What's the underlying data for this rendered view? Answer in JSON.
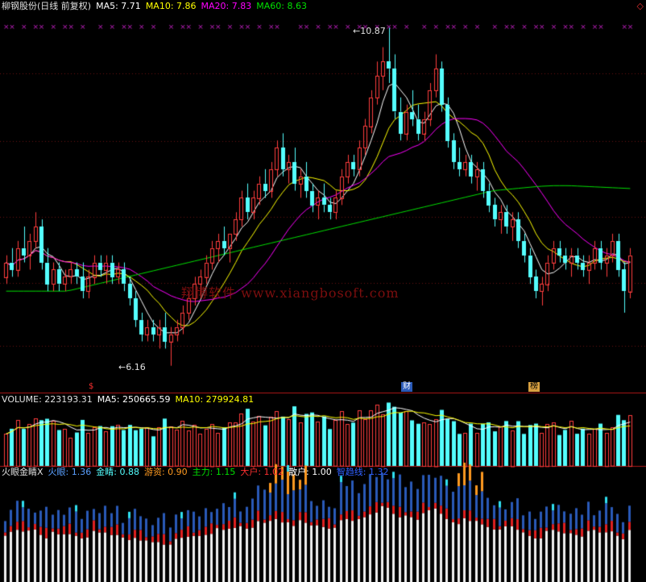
{
  "header_price": {
    "name": "柳钢股份(日线 前复权)",
    "ma5": "MA5: 7.71",
    "ma10": "MA10: 7.86",
    "ma20": "MA20: 7.83",
    "ma60": "MA60: 8.63"
  },
  "header_volume": {
    "volume": "VOLUME: 223193.31",
    "ma5": "MA5: 250665.59",
    "ma10": "MA10: 279924.81"
  },
  "header_indicator": {
    "name": "火眼金睛X",
    "huoyan": "火眼: 1.36",
    "jinjing": "金睛: 0.88",
    "youzi": "游资: 0.90",
    "zhuli": "主力: 1.15",
    "dahu": "大户: 1.02",
    "sanhu": "散户: 1.00",
    "zhiduxian": "智趋线: 1.32"
  },
  "watermark": "翔博软件 www.xiangbosoft.com",
  "markers": {
    "s": "$",
    "cai": "财",
    "bang": "榜"
  },
  "annotations": {
    "high": "10.87",
    "low": "6.16"
  },
  "colors": {
    "up": "#ff3c3c",
    "down": "#54ffff",
    "ma5": "#ffffff",
    "ma10": "#ffff00",
    "ma20": "#ff00ff",
    "ma60": "#00e000",
    "white_bar": "#f0f0f0",
    "blue_bar": "#2a5ab8",
    "red_bar": "#e02020",
    "orange_bar": "#ff9a20",
    "cyan_bar": "#30e0f0"
  },
  "chart_data": {
    "type": "candlestick",
    "price_range": [
      6.0,
      11.1
    ],
    "candles_ohlc": [
      [
        7.4,
        7.7,
        7.3,
        7.6
      ],
      [
        7.6,
        7.8,
        7.4,
        7.5
      ],
      [
        7.5,
        7.9,
        7.4,
        7.8
      ],
      [
        7.8,
        8.1,
        7.6,
        7.7
      ],
      [
        7.7,
        8.0,
        7.5,
        7.9
      ],
      [
        7.9,
        8.3,
        7.8,
        8.1
      ],
      [
        8.1,
        8.2,
        7.5,
        7.6
      ],
      [
        7.6,
        7.8,
        7.2,
        7.3
      ],
      [
        7.3,
        7.6,
        7.2,
        7.5
      ],
      [
        7.5,
        7.6,
        7.2,
        7.3
      ],
      [
        7.3,
        7.5,
        7.2,
        7.4
      ],
      [
        7.4,
        7.6,
        7.3,
        7.5
      ],
      [
        7.5,
        7.6,
        7.3,
        7.4
      ],
      [
        7.4,
        7.6,
        7.1,
        7.2
      ],
      [
        7.2,
        7.5,
        7.1,
        7.4
      ],
      [
        7.4,
        7.7,
        7.3,
        7.6
      ],
      [
        7.6,
        7.7,
        7.4,
        7.5
      ],
      [
        7.5,
        7.7,
        7.3,
        7.6
      ],
      [
        7.6,
        7.7,
        7.3,
        7.4
      ],
      [
        7.4,
        7.6,
        7.3,
        7.5
      ],
      [
        7.5,
        7.6,
        7.2,
        7.3
      ],
      [
        7.3,
        7.4,
        7.0,
        7.1
      ],
      [
        7.1,
        7.2,
        6.7,
        6.8
      ],
      [
        6.8,
        6.9,
        6.5,
        6.6
      ],
      [
        6.6,
        6.8,
        6.5,
        6.7
      ],
      [
        6.7,
        6.8,
        6.5,
        6.6
      ],
      [
        6.6,
        6.8,
        6.4,
        6.7
      ],
      [
        6.7,
        6.9,
        6.4,
        6.5
      ],
      [
        6.5,
        6.7,
        6.16,
        6.6
      ],
      [
        6.6,
        6.8,
        6.5,
        6.7
      ],
      [
        6.7,
        7.0,
        6.6,
        6.9
      ],
      [
        6.9,
        7.2,
        6.8,
        7.1
      ],
      [
        7.1,
        7.4,
        7.0,
        7.3
      ],
      [
        7.3,
        7.5,
        7.1,
        7.4
      ],
      [
        7.4,
        7.7,
        7.3,
        7.6
      ],
      [
        7.6,
        7.9,
        7.5,
        7.8
      ],
      [
        7.8,
        8.0,
        7.6,
        7.9
      ],
      [
        7.9,
        8.1,
        7.7,
        7.8
      ],
      [
        7.8,
        8.0,
        7.6,
        8.0
      ],
      [
        8.0,
        8.3,
        7.9,
        8.2
      ],
      [
        8.2,
        8.6,
        8.1,
        8.5
      ],
      [
        8.5,
        8.7,
        8.2,
        8.3
      ],
      [
        8.3,
        8.6,
        8.2,
        8.5
      ],
      [
        8.5,
        8.8,
        8.4,
        8.7
      ],
      [
        8.7,
        8.9,
        8.5,
        8.6
      ],
      [
        8.6,
        9.0,
        8.5,
        8.9
      ],
      [
        8.9,
        9.3,
        8.8,
        9.2
      ],
      [
        9.2,
        9.4,
        8.8,
        8.9
      ],
      [
        8.9,
        9.1,
        8.7,
        9.0
      ],
      [
        9.0,
        9.2,
        8.6,
        8.7
      ],
      [
        8.7,
        8.9,
        8.5,
        8.8
      ],
      [
        8.8,
        9.0,
        8.5,
        8.6
      ],
      [
        8.6,
        8.7,
        8.3,
        8.4
      ],
      [
        8.4,
        8.6,
        8.2,
        8.5
      ],
      [
        8.5,
        8.7,
        8.3,
        8.4
      ],
      [
        8.4,
        8.5,
        8.2,
        8.3
      ],
      [
        8.3,
        8.6,
        8.2,
        8.5
      ],
      [
        8.5,
        8.9,
        8.4,
        8.8
      ],
      [
        8.8,
        9.1,
        8.7,
        9.0
      ],
      [
        9.0,
        9.1,
        8.8,
        8.9
      ],
      [
        8.9,
        9.3,
        8.8,
        9.2
      ],
      [
        9.2,
        9.6,
        9.1,
        9.5
      ],
      [
        9.5,
        10.0,
        9.4,
        9.9
      ],
      [
        9.9,
        10.4,
        9.8,
        10.2
      ],
      [
        10.2,
        10.6,
        10.0,
        10.4
      ],
      [
        10.4,
        10.87,
        10.1,
        10.3
      ],
      [
        10.3,
        10.5,
        9.6,
        9.7
      ],
      [
        9.7,
        9.9,
        9.3,
        9.4
      ],
      [
        9.4,
        9.8,
        9.3,
        9.7
      ],
      [
        9.7,
        10.0,
        9.5,
        9.6
      ],
      [
        9.6,
        9.8,
        9.3,
        9.4
      ],
      [
        9.4,
        9.7,
        9.3,
        9.6
      ],
      [
        9.6,
        10.1,
        9.5,
        10.0
      ],
      [
        10.0,
        10.5,
        9.9,
        10.3
      ],
      [
        10.3,
        10.4,
        9.7,
        9.8
      ],
      [
        9.8,
        9.9,
        9.2,
        9.3
      ],
      [
        9.3,
        9.4,
        8.9,
        9.0
      ],
      [
        9.0,
        9.2,
        8.8,
        8.9
      ],
      [
        8.9,
        9.1,
        8.8,
        9.0
      ],
      [
        9.0,
        9.1,
        8.7,
        8.8
      ],
      [
        8.8,
        9.0,
        8.6,
        8.9
      ],
      [
        8.9,
        9.0,
        8.5,
        8.6
      ],
      [
        8.6,
        8.7,
        8.3,
        8.4
      ],
      [
        8.4,
        8.5,
        8.1,
        8.2
      ],
      [
        8.2,
        8.4,
        8.0,
        8.3
      ],
      [
        8.3,
        8.4,
        8.0,
        8.1
      ],
      [
        8.1,
        8.3,
        7.9,
        8.2
      ],
      [
        8.2,
        8.3,
        7.8,
        7.9
      ],
      [
        7.9,
        8.0,
        7.6,
        7.7
      ],
      [
        7.7,
        7.8,
        7.3,
        7.4
      ],
      [
        7.4,
        7.5,
        7.1,
        7.2
      ],
      [
        7.2,
        7.4,
        7.0,
        7.3
      ],
      [
        7.3,
        7.7,
        7.2,
        7.6
      ],
      [
        7.6,
        7.9,
        7.5,
        7.8
      ],
      [
        7.8,
        7.9,
        7.6,
        7.7
      ],
      [
        7.7,
        7.8,
        7.5,
        7.6
      ],
      [
        7.6,
        7.8,
        7.4,
        7.7
      ],
      [
        7.7,
        7.8,
        7.5,
        7.6
      ],
      [
        7.6,
        7.7,
        7.4,
        7.5
      ],
      [
        7.5,
        7.7,
        7.3,
        7.6
      ],
      [
        7.6,
        7.9,
        7.5,
        7.8
      ],
      [
        7.8,
        7.9,
        7.5,
        7.6
      ],
      [
        7.6,
        7.8,
        7.4,
        7.7
      ],
      [
        7.7,
        8.0,
        7.6,
        7.9
      ],
      [
        7.9,
        8.0,
        7.4,
        7.5
      ],
      [
        7.5,
        7.6,
        6.9,
        7.2
      ],
      [
        7.2,
        7.8,
        7.1,
        7.7
      ]
    ],
    "ma60_values": [
      7.2,
      7.2,
      7.2,
      7.2,
      7.2,
      7.25,
      7.3,
      7.35,
      7.4,
      7.45,
      7.5,
      7.55,
      7.6,
      7.65,
      7.7,
      7.75,
      7.8,
      7.85,
      7.9,
      7.95,
      8.0,
      8.05,
      8.1,
      8.15,
      8.2,
      8.25,
      8.3,
      8.35,
      8.4,
      8.45,
      8.5,
      8.55,
      8.6,
      8.62,
      8.64,
      8.66,
      8.67,
      8.67,
      8.66,
      8.65,
      8.64,
      8.63
    ],
    "volume_max": 440000,
    "volume_ma_note": "volume bars paired with MA5/MA10 lines"
  }
}
